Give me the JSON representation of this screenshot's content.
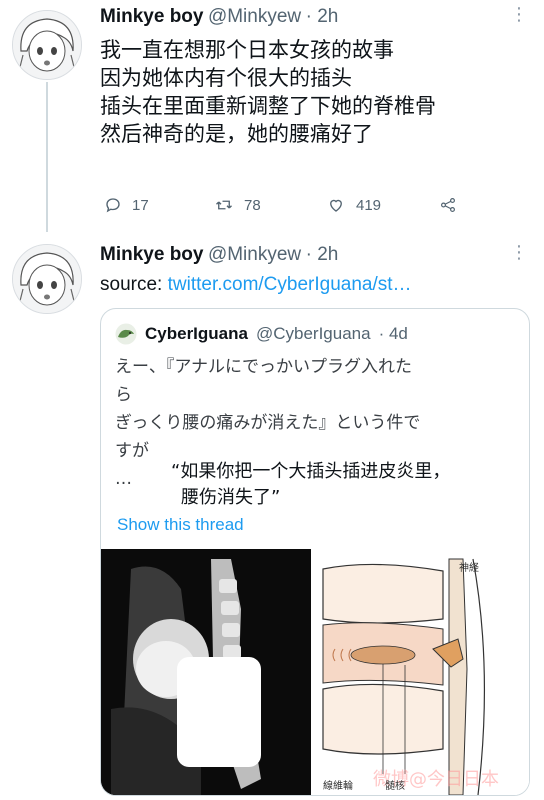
{
  "tweet1": {
    "author": "Minkye boy",
    "handle": "@Minkyew",
    "time": "· 2h",
    "text_lines": [
      "我一直在想那个日本女孩的故事",
      "因为她体内有个很大的插头",
      "插头在里面重新调整了下她的脊椎骨",
      "然后神奇的是，她的腰痛好了"
    ],
    "replies": "17",
    "retweets": "78",
    "likes": "419",
    "icons": [
      "reply-icon",
      "retweet-icon",
      "like-icon",
      "share-icon",
      "more-icon"
    ]
  },
  "tweet2": {
    "author": "Minkye boy",
    "handle": "@Minkyew",
    "time": "· 2h",
    "source_label": "source:",
    "source_link": "twitter.com/CyberIguana/st…",
    "quote": {
      "author": "CyberIguana",
      "handle": "@CyberIguana",
      "time": "· 4d",
      "text_lines": [
        "えー、『アナルにでっかいプラグ入れた",
        "ら",
        "ぎっくり腰の痛みが消えた』という件で",
        "すが"
      ],
      "ellipsis": "…",
      "overlay_lines": [
        "“如果你把一个大插头插进皮炎里，",
        "腰伤消失了”"
      ],
      "show_thread": "Show this thread",
      "diagram_labels": {
        "nerve": "神経",
        "annulus": "線維輪",
        "nucleus": "髄核"
      },
      "watermark": "微博@今日日本"
    }
  },
  "colors": {
    "accent": "#1d9bf0",
    "muted": "#536471",
    "border": "#cfd9de"
  }
}
